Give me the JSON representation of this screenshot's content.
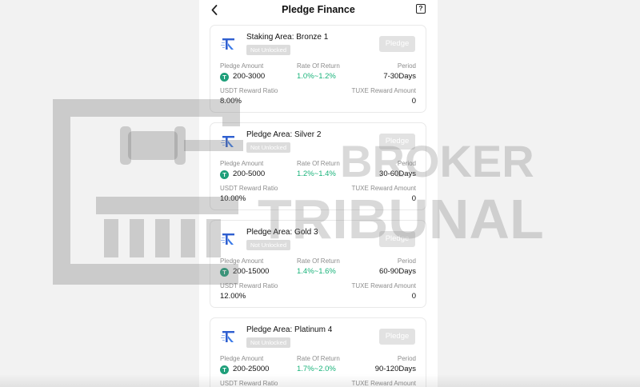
{
  "header": {
    "title": "Pledge Finance",
    "back_icon": "chevron-left-icon",
    "help_icon": "question-mark-icon",
    "help_glyph": "?"
  },
  "labels": {
    "pledge_amount": "Pledge Amount",
    "rate_of_return": "Rate Of Return",
    "period": "Period",
    "usdt_ratio": "USDT Reward Ratio",
    "tuxe_amount": "TUXE Reward Amount",
    "pledge_button": "Pledge",
    "not_unlocked": "Not Unlocked",
    "usdt_glyph": "T"
  },
  "colors": {
    "rate_green": "#19b37a",
    "usdt_coin": "#1e9f7a",
    "disabled_button": "#e2e2e2",
    "badge_grey": "#dcdcdc"
  },
  "cards": [
    {
      "name": "Staking Area: Bronze 1",
      "status": "Not Unlocked",
      "amount": "200-3000",
      "rate": "1.0%~1.2%",
      "period": "7-30Days",
      "usdt_ratio": "8.00%",
      "tuxe_amount": "0"
    },
    {
      "name": "Pledge Area: Silver 2",
      "status": "Not Unlocked",
      "amount": "200-5000",
      "rate": "1.2%~1.4%",
      "period": "30-60Days",
      "usdt_ratio": "10.00%",
      "tuxe_amount": "0"
    },
    {
      "name": "Pledge Area: Gold 3",
      "status": "Not Unlocked",
      "amount": "200-15000",
      "rate": "1.4%~1.6%",
      "period": "60-90Days",
      "usdt_ratio": "12.00%",
      "tuxe_amount": "0"
    },
    {
      "name": "Pledge Area: Platinum 4",
      "status": "Not Unlocked",
      "amount": "200-25000",
      "rate": "1.7%~2.0%",
      "period": "90-120Days",
      "usdt_ratio": "",
      "tuxe_amount": ""
    }
  ],
  "watermark": {
    "line1": "BROKER",
    "line2": "TRIBUNAL",
    "icon": "courthouse-gavel-logo"
  }
}
